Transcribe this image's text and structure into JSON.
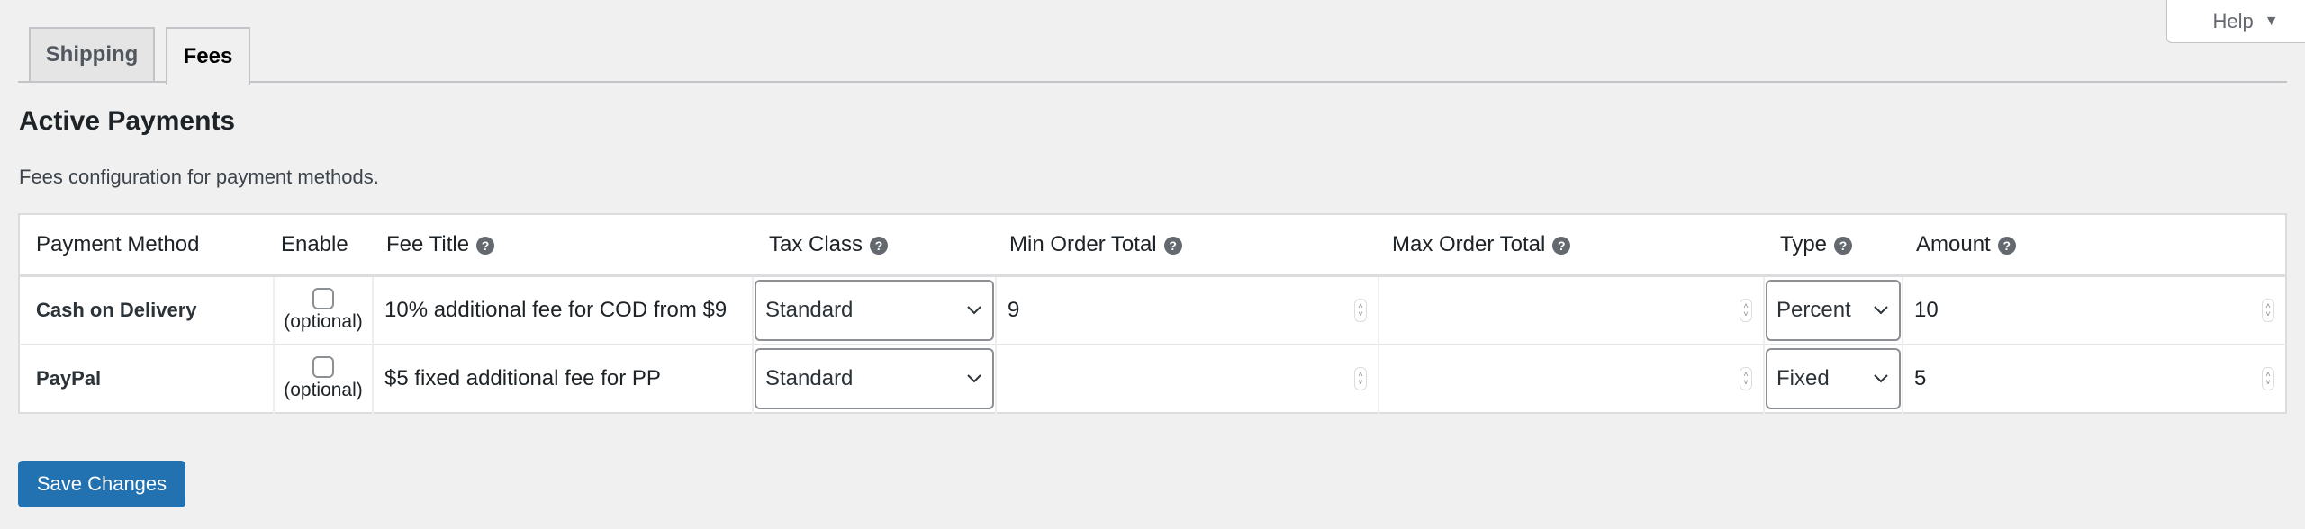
{
  "help": {
    "label": "Help",
    "caret": "▼"
  },
  "tabs": [
    {
      "label": "Shipping",
      "active": false
    },
    {
      "label": "Fees",
      "active": true
    }
  ],
  "section": {
    "title": "Active Payments",
    "description": "Fees configuration for payment methods."
  },
  "table": {
    "help_glyph": "?",
    "headers": {
      "payment_method": "Payment Method",
      "enable": "Enable",
      "fee_title": "Fee Title",
      "tax_class": "Tax Class",
      "min_order_total": "Min Order Total",
      "max_order_total": "Max Order Total",
      "type": "Type",
      "amount": "Amount"
    },
    "rows": [
      {
        "payment_method": "Cash on Delivery",
        "enabled": false,
        "enable_note": "(optional)",
        "fee_title": "10% additional fee for COD from $9",
        "tax_class": "Standard",
        "min_order_total": "9",
        "max_order_total": "",
        "type": "Percent",
        "amount": "10"
      },
      {
        "payment_method": "PayPal",
        "enabled": false,
        "enable_note": "(optional)",
        "fee_title": "$5 fixed additional fee for PP",
        "tax_class": "Standard",
        "min_order_total": "",
        "max_order_total": "",
        "type": "Fixed",
        "amount": "5"
      }
    ]
  },
  "save_button": {
    "label": "Save Changes"
  },
  "colors": {
    "primary": "#2271b1",
    "background": "#f0f0f1"
  }
}
